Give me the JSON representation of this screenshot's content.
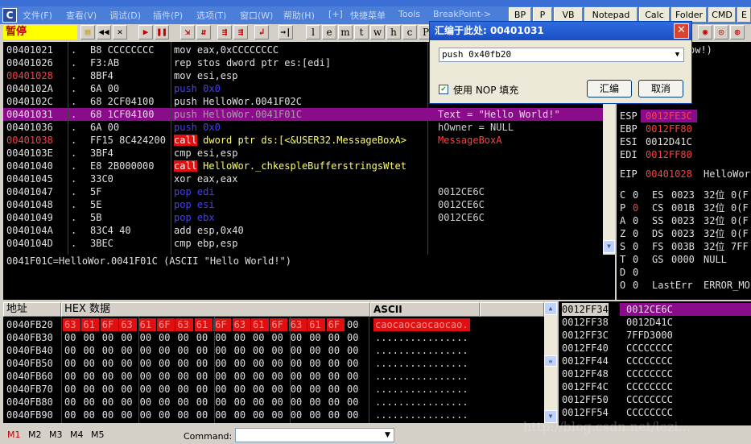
{
  "menubar": {
    "app_icon": "C",
    "items": [
      "文件(F)",
      "查看(V)",
      "调试(D)",
      "插件(P)",
      "选项(T)",
      "窗口(W)",
      "帮助(H)",
      "[+]",
      "快捷菜单",
      "Tools",
      "BreakPoint->"
    ],
    "plugins": [
      "BP",
      "P",
      "VB",
      "Notepad",
      "Calc",
      "Folder",
      "CMD",
      "E"
    ]
  },
  "toolbar": {
    "status": "暂停",
    "letters": [
      "l",
      "e",
      "m",
      "t",
      "w",
      "h",
      "c",
      "P"
    ]
  },
  "cpu": {
    "rows": [
      {
        "addr": "00401021",
        "bp": false,
        "mark": ".",
        "hex": "B8 CCCCCCCC",
        "ins": "mov eax,0xCCCCCCCC",
        "kind": "white"
      },
      {
        "addr": "00401026",
        "bp": false,
        "mark": ".",
        "hex": "F3:AB",
        "ins": "rep stos dword ptr es:[edi]",
        "kind": "white"
      },
      {
        "addr": "00401028",
        "bp": true,
        "mark": ".",
        "hex": "8BF4",
        "ins": "mov esi,esp",
        "kind": "white"
      },
      {
        "addr": "0040102A",
        "bp": false,
        "mark": ".",
        "hex": "6A 00",
        "ins": "push 0x0",
        "kind": "blue"
      },
      {
        "addr": "0040102C",
        "bp": false,
        "mark": ".",
        "hex": "68 2CF04100",
        "ins": "push HelloWor.0041F02C",
        "kind": "white"
      },
      {
        "addr": "00401031",
        "bp": false,
        "mark": ".",
        "hex": "68 1CF04100",
        "ins": "push HelloWor.0041F01C",
        "kind": "selected"
      },
      {
        "addr": "00401036",
        "bp": false,
        "mark": ".",
        "hex": "6A 00",
        "ins": "push 0x0",
        "kind": "blue"
      },
      {
        "addr": "00401038",
        "bp": true,
        "mark": ".",
        "hex": "FF15 8C424200",
        "ins": "call dword ptr ds:[<&USER32.MessageBoxA>",
        "kind": "call"
      },
      {
        "addr": "0040103E",
        "bp": false,
        "mark": ".",
        "hex": "3BF4",
        "ins": "cmp esi,esp",
        "kind": "white"
      },
      {
        "addr": "00401040",
        "bp": false,
        "mark": ".",
        "hex": "E8 2B000000",
        "ins": "call HelloWor._chkespleBufferstringsWtet",
        "kind": "call"
      },
      {
        "addr": "00401045",
        "bp": false,
        "mark": ".",
        "hex": "33C0",
        "ins": "xor eax,eax",
        "kind": "white"
      },
      {
        "addr": "00401047",
        "bp": false,
        "mark": ".",
        "hex": "5F",
        "ins": "pop edi",
        "kind": "blue"
      },
      {
        "addr": "00401048",
        "bp": false,
        "mark": ".",
        "hex": "5E",
        "ins": "pop esi",
        "kind": "blue"
      },
      {
        "addr": "00401049",
        "bp": false,
        "mark": ".",
        "hex": "5B",
        "ins": "pop ebx",
        "kind": "blue"
      },
      {
        "addr": "0040104A",
        "bp": false,
        "mark": ".",
        "hex": "83C4 40",
        "ins": "add esp,0x40",
        "kind": "white"
      },
      {
        "addr": "0040104D",
        "bp": false,
        "mark": ".",
        "hex": "3BEC",
        "ins": "cmp ebp,esp",
        "kind": "white"
      }
    ],
    "comments": [
      {
        "row": 5,
        "text": "Text = \"Hello World!\"",
        "selected": true
      },
      {
        "row": 6,
        "text": "hOwner = NULL",
        "selected": false
      },
      {
        "row": 7,
        "text": "MessageBoxA",
        "selected": false,
        "red": true
      },
      {
        "row": 11,
        "text": "0012CE6C",
        "selected": false
      },
      {
        "row": 12,
        "text": "0012CE6C",
        "selected": false
      },
      {
        "row": 13,
        "text": "0012CE6C",
        "selected": false
      }
    ]
  },
  "info": {
    "line": "0041F01C=HelloWor.0041F01C (ASCII \"Hello World!\")"
  },
  "registers": {
    "top_partial": "ow!)",
    "rows": [
      {
        "name": "ESP",
        "value": "0012FE3C",
        "tail": "",
        "hl": true
      },
      {
        "name": "EBP",
        "value": "0012FF80",
        "tail": "",
        "red": true
      },
      {
        "name": "ESI",
        "value": "0012D41C",
        "tail": "",
        "red": false
      },
      {
        "name": "EDI",
        "value": "0012FF80",
        "tail": "",
        "red": true
      }
    ],
    "eip": {
      "name": "EIP",
      "value": "00401028",
      "tail": "HelloWor"
    },
    "flags": [
      {
        "f": "C",
        "v": "0",
        "seg": "ES",
        "sv": "0023",
        "w": "32位",
        "x": "0(F"
      },
      {
        "f": "P",
        "v": "0",
        "seg": "CS",
        "sv": "001B",
        "w": "32位",
        "x": "0(F"
      },
      {
        "f": "A",
        "v": "0",
        "seg": "SS",
        "sv": "0023",
        "w": "32位",
        "x": "0(F"
      },
      {
        "f": "Z",
        "v": "0",
        "seg": "DS",
        "sv": "0023",
        "w": "32位",
        "x": "0(F"
      },
      {
        "f": "S",
        "v": "0",
        "seg": "FS",
        "sv": "003B",
        "w": "32位",
        "x": "7FF"
      },
      {
        "f": "T",
        "v": "0",
        "seg": "GS",
        "sv": "0000",
        "w": "NULL",
        "x": ""
      },
      {
        "f": "D",
        "v": "0",
        "seg": "",
        "sv": "",
        "w": "",
        "x": ""
      },
      {
        "f": "O",
        "v": "0",
        "seg": "LastErr",
        "sv": "",
        "w": "ERROR_MO",
        "x": ""
      }
    ]
  },
  "dialog": {
    "title": "汇编于此处: 00401031",
    "input": "push 0x40fb20",
    "checkbox": "使用 NOP 填充",
    "checked": true,
    "assemble": "汇编",
    "cancel": "取消",
    "close": "✕"
  },
  "dump": {
    "hdr_addr": "地址",
    "hdr_hex": "HEX 数据",
    "hdr_ascii": "ASCII",
    "rows": [
      {
        "addr": "0040FB20",
        "hex": [
          "63",
          "61",
          "6F",
          "63",
          "61",
          "6F",
          "63",
          "61",
          "6F",
          "63",
          "61",
          "6F",
          "63",
          "61",
          "6F",
          "00"
        ],
        "ascii": "caocaocaocaocao.",
        "hl": true
      },
      {
        "addr": "0040FB30",
        "hex": [
          "00",
          "00",
          "00",
          "00",
          "00",
          "00",
          "00",
          "00",
          "00",
          "00",
          "00",
          "00",
          "00",
          "00",
          "00",
          "00"
        ],
        "ascii": "................",
        "hl": false
      },
      {
        "addr": "0040FB40",
        "hex": [
          "00",
          "00",
          "00",
          "00",
          "00",
          "00",
          "00",
          "00",
          "00",
          "00",
          "00",
          "00",
          "00",
          "00",
          "00",
          "00"
        ],
        "ascii": "................",
        "hl": false
      },
      {
        "addr": "0040FB50",
        "hex": [
          "00",
          "00",
          "00",
          "00",
          "00",
          "00",
          "00",
          "00",
          "00",
          "00",
          "00",
          "00",
          "00",
          "00",
          "00",
          "00"
        ],
        "ascii": "................",
        "hl": false
      },
      {
        "addr": "0040FB60",
        "hex": [
          "00",
          "00",
          "00",
          "00",
          "00",
          "00",
          "00",
          "00",
          "00",
          "00",
          "00",
          "00",
          "00",
          "00",
          "00",
          "00"
        ],
        "ascii": "................",
        "hl": false
      },
      {
        "addr": "0040FB70",
        "hex": [
          "00",
          "00",
          "00",
          "00",
          "00",
          "00",
          "00",
          "00",
          "00",
          "00",
          "00",
          "00",
          "00",
          "00",
          "00",
          "00"
        ],
        "ascii": "................",
        "hl": false
      },
      {
        "addr": "0040FB80",
        "hex": [
          "00",
          "00",
          "00",
          "00",
          "00",
          "00",
          "00",
          "00",
          "00",
          "00",
          "00",
          "00",
          "00",
          "00",
          "00",
          "00"
        ],
        "ascii": "................",
        "hl": false
      },
      {
        "addr": "0040FB90",
        "hex": [
          "00",
          "00",
          "00",
          "00",
          "00",
          "00",
          "00",
          "00",
          "00",
          "00",
          "00",
          "00",
          "00",
          "00",
          "00",
          "00"
        ],
        "ascii": "................",
        "hl": false
      }
    ]
  },
  "stack": {
    "rows": [
      {
        "addr": "0012FF34",
        "val": "0012CE6C",
        "hl": true
      },
      {
        "addr": "0012FF38",
        "val": "0012D41C",
        "hl": false
      },
      {
        "addr": "0012FF3C",
        "val": "7FFD3000",
        "hl": false
      },
      {
        "addr": "0012FF40",
        "val": "CCCCCCCC",
        "hl": false
      },
      {
        "addr": "0012FF44",
        "val": "CCCCCCCC",
        "hl": false
      },
      {
        "addr": "0012FF48",
        "val": "CCCCCCCC",
        "hl": false
      },
      {
        "addr": "0012FF4C",
        "val": "CCCCCCCC",
        "hl": false
      },
      {
        "addr": "0012FF50",
        "val": "CCCCCCCC",
        "hl": false
      },
      {
        "addr": "0012FF54",
        "val": "CCCCCCCC",
        "hl": false
      }
    ]
  },
  "bottombar": {
    "tabs": [
      "M1",
      "M2",
      "M3",
      "M4",
      "M5"
    ],
    "command_label": "Command:",
    "watermark": "http://blog.csdn.net/lezi..."
  }
}
